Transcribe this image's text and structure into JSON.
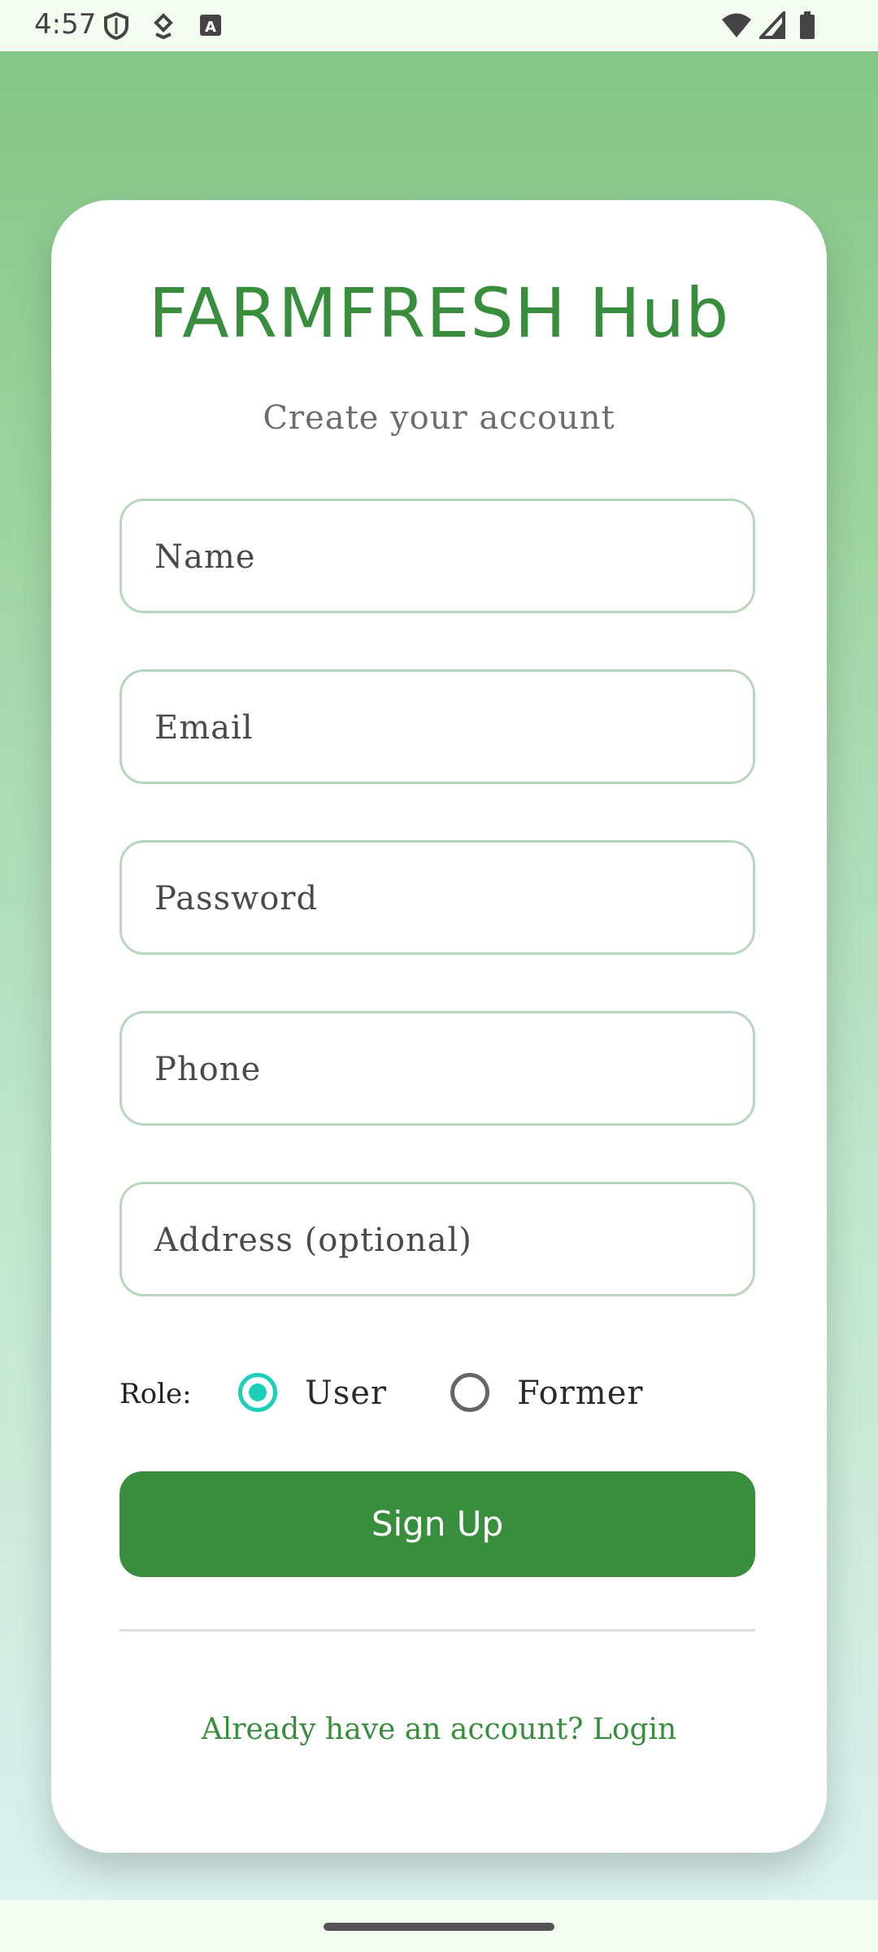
{
  "status_bar": {
    "time": "4:57",
    "icons_left": [
      "shield-icon",
      "download-icon",
      "keyboard-a-icon"
    ],
    "icons_right": [
      "wifi-icon",
      "cellular-signal-icon",
      "battery-icon"
    ]
  },
  "app": {
    "title": "FARMFRESH Hub",
    "subtitle": "Create your account"
  },
  "form": {
    "fields": [
      {
        "placeholder": "Name"
      },
      {
        "placeholder": "Email"
      },
      {
        "placeholder": "Password"
      },
      {
        "placeholder": "Phone"
      },
      {
        "placeholder": "Address (optional)"
      }
    ],
    "role_label": "Role:",
    "roles": [
      {
        "label": "User",
        "selected": true
      },
      {
        "label": "Former",
        "selected": false
      }
    ],
    "submit_label": "Sign Up",
    "login_prompt": "Already have an account? Login"
  },
  "colors": {
    "primary": "#388e3c",
    "radio_accent": "#1ccfb8",
    "field_border": "#b7d6bd"
  }
}
